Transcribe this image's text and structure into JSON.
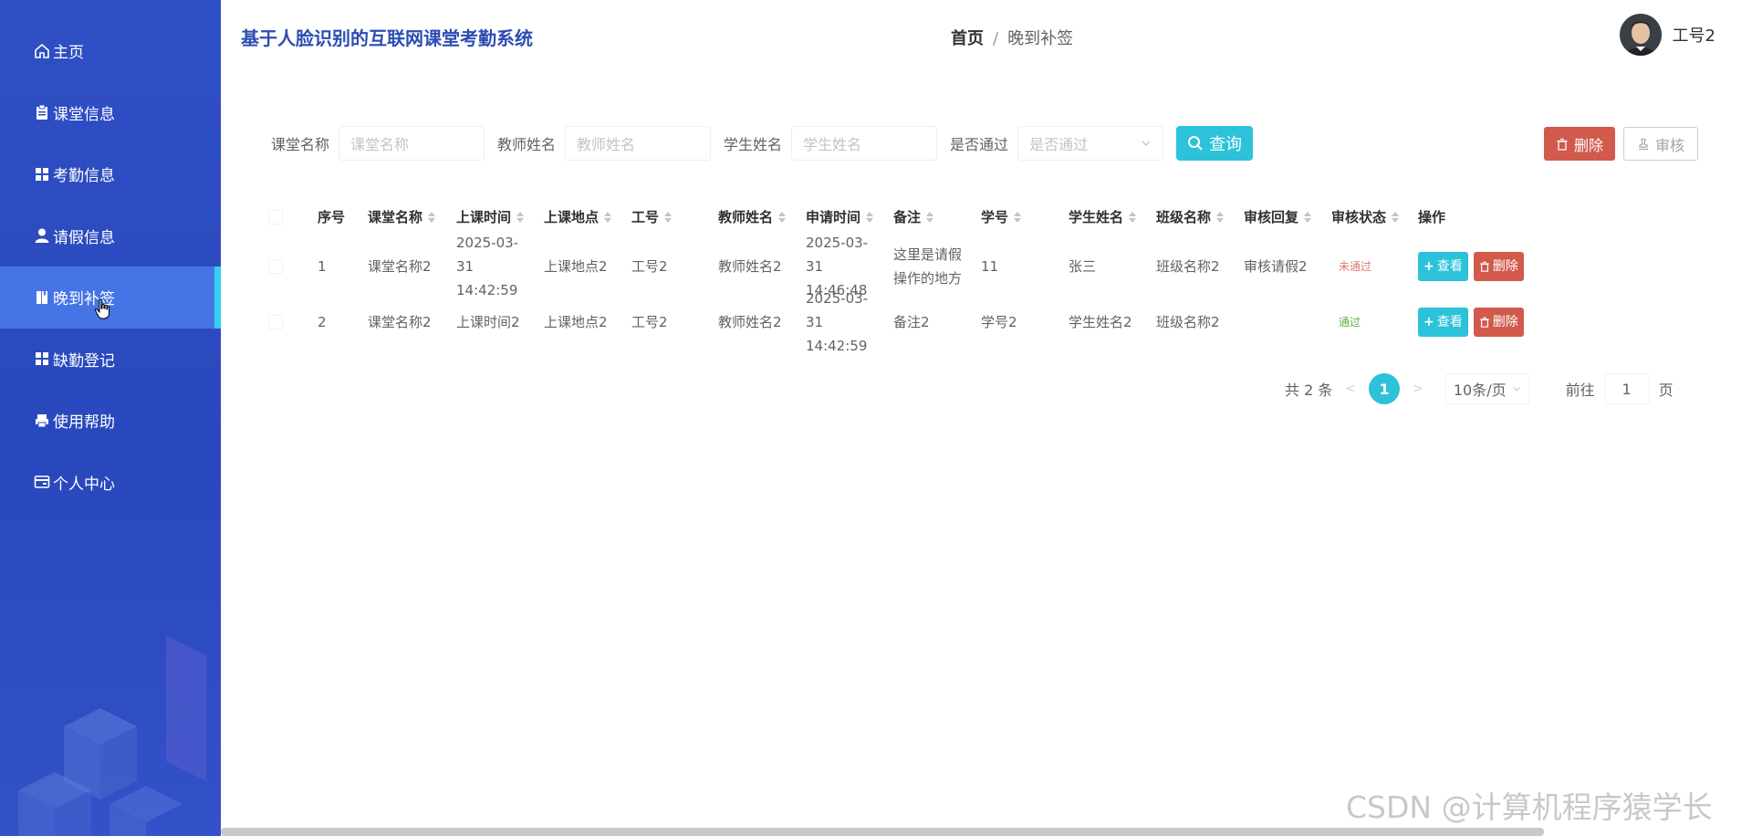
{
  "app": {
    "title": "基于人脸识别的互联网课堂考勤系统"
  },
  "sidebar": {
    "items": [
      {
        "label": "主页",
        "icon": "home-icon"
      },
      {
        "label": "课堂信息",
        "icon": "clipboard-icon"
      },
      {
        "label": "考勤信息",
        "icon": "grid-icon"
      },
      {
        "label": "请假信息",
        "icon": "user-icon"
      },
      {
        "label": "晚到补签",
        "icon": "book-icon",
        "active": true
      },
      {
        "label": "缺勤登记",
        "icon": "grid-icon"
      },
      {
        "label": "使用帮助",
        "icon": "printer-icon"
      },
      {
        "label": "个人中心",
        "icon": "card-icon"
      }
    ]
  },
  "breadcrumb": {
    "home": "首页",
    "separator": "/",
    "current": "晚到补签"
  },
  "user": {
    "name": "工号2"
  },
  "search": {
    "course_label": "课堂名称",
    "course_placeholder": "课堂名称",
    "teacher_label": "教师姓名",
    "teacher_placeholder": "教师姓名",
    "student_label": "学生姓名",
    "student_placeholder": "学生姓名",
    "passed_label": "是否通过",
    "passed_placeholder": "是否通过",
    "query_button": "查询"
  },
  "actions": {
    "delete_button": "删除",
    "audit_button": "审核"
  },
  "table": {
    "headers": [
      "序号",
      "课堂名称",
      "上课时间",
      "上课地点",
      "工号",
      "教师姓名",
      "申请时间",
      "备注",
      "学号",
      "学生姓名",
      "班级名称",
      "审核回复",
      "审核状态",
      "操作"
    ],
    "rows": [
      {
        "index": "1",
        "course": "课堂名称2",
        "class_time": "2025-03-31 14:42:59",
        "location": "上课地点2",
        "job_no": "工号2",
        "teacher": "教师姓名2",
        "apply_time": "2025-03-31 14:46:48",
        "remark": "这里是请假操作的地方",
        "student_no": "11",
        "student": "张三",
        "class_name": "班级名称2",
        "reply": "审核请假2",
        "status": "未通过"
      },
      {
        "index": "2",
        "course": "课堂名称2",
        "class_time": "上课时间2",
        "location": "上课地点2",
        "job_no": "工号2",
        "teacher": "教师姓名2",
        "apply_time": "2025-03-31 14:42:59",
        "remark": "备注2",
        "student_no": "学号2",
        "student": "学生姓名2",
        "class_name": "班级名称2",
        "reply": "",
        "status": "通过"
      }
    ],
    "view_button": "查看",
    "delete_button": "删除"
  },
  "pagination": {
    "total": "共 2 条",
    "current_page": "1",
    "page_size": "10条/页",
    "goto_prefix": "前往",
    "goto_value": "1",
    "goto_suffix": "页"
  },
  "watermark": "CSDN @计算机程序猿学长",
  "colors": {
    "sidebar": "#2f4fc4",
    "accent": "#2cc2d9",
    "danger": "#d15a4d",
    "active_item": "#4574e6"
  }
}
